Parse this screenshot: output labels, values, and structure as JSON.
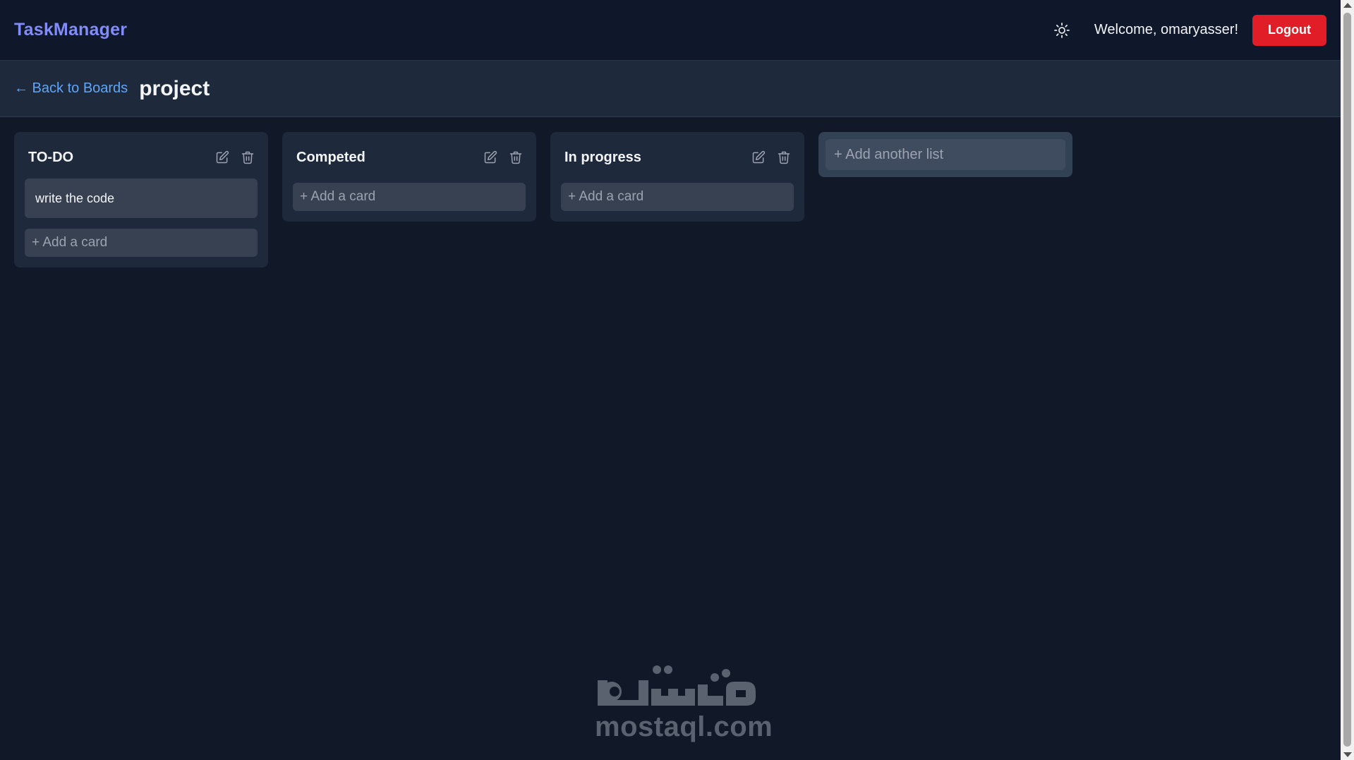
{
  "header": {
    "brand": "TaskManager",
    "welcome": "Welcome, omaryasser!",
    "logout_label": "Logout",
    "theme_icon": "sun-icon"
  },
  "subheader": {
    "back_label": "← Back to Boards",
    "board_title": "project"
  },
  "lists": [
    {
      "title": "TO-DO",
      "cards": [
        "write the code"
      ],
      "add_card_label": "+ Add a card"
    },
    {
      "title": "Competed",
      "cards": [],
      "add_card_label": "+ Add a card"
    },
    {
      "title": "In progress",
      "cards": [],
      "add_card_label": "+ Add a card"
    }
  ],
  "add_list": {
    "placeholder": "+ Add another list"
  },
  "watermark": {
    "text": "mostaql.com",
    "logo_text": "مستقل"
  },
  "colors": {
    "background": "#111827",
    "brand": "#818cf8",
    "logout": "#e11d28",
    "link": "#60a5fa",
    "list_bg": "#1e293b",
    "card_bg": "#374151"
  }
}
